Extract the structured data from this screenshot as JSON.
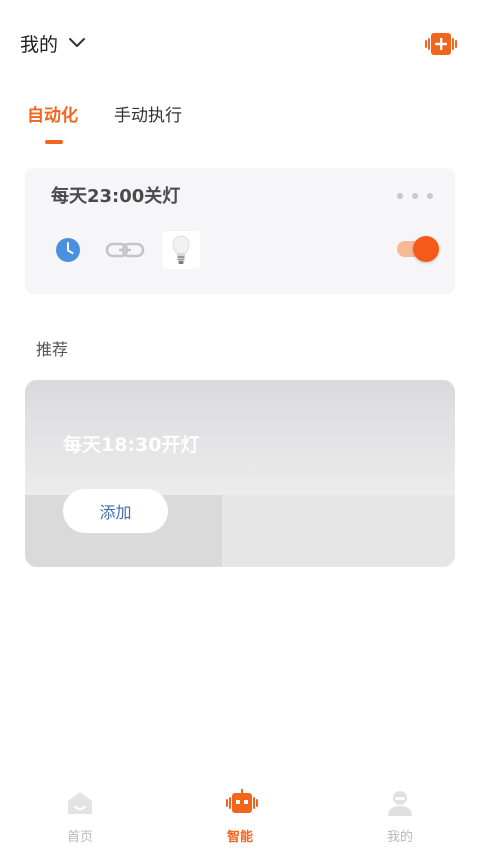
{
  "header": {
    "home_label": "我的"
  },
  "tabs": [
    {
      "label": "自动化",
      "active": true
    },
    {
      "label": "手动执行",
      "active": false
    }
  ],
  "scene": {
    "title": "每天23:00关灯",
    "enabled": true,
    "icons": [
      "clock-icon",
      "link-icon",
      "bulb-icon"
    ]
  },
  "recommend": {
    "section_title": "推荐",
    "card_title": "每天18:30开灯",
    "add_label": "添加"
  },
  "bottom_nav": [
    {
      "label": "首页",
      "icon": "home-icon",
      "active": false
    },
    {
      "label": "智能",
      "icon": "robot-icon",
      "active": true
    },
    {
      "label": "我的",
      "icon": "user-icon",
      "active": false
    }
  ],
  "colors": {
    "accent": "#f2651c",
    "link_blue": "#3f6fb5",
    "clock_blue": "#4a90e2"
  }
}
